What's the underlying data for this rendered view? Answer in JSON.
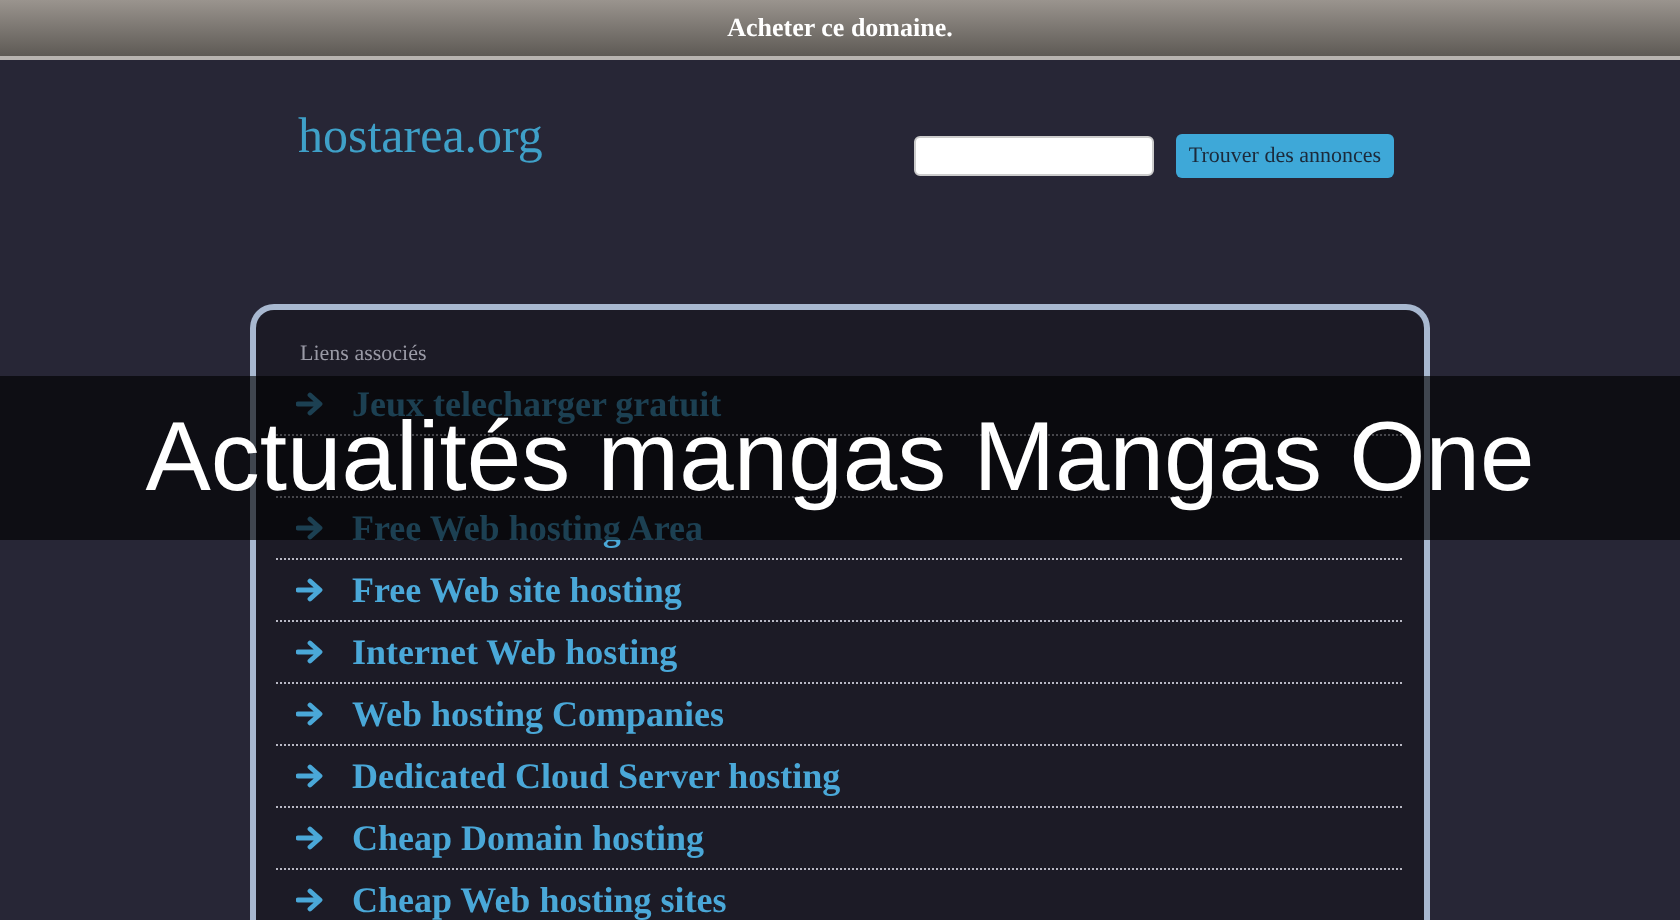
{
  "top_bar": {
    "label": "Acheter ce domaine."
  },
  "header": {
    "logo": "hostarea.org",
    "search": {
      "button": "Trouver des annonces"
    }
  },
  "panel": {
    "heading": "Liens associés",
    "links": [
      {
        "kind": "link",
        "label": "Jeux telecharger gratuit"
      },
      {
        "kind": "covered"
      },
      {
        "kind": "link",
        "label": "Free Web hosting Area"
      },
      {
        "kind": "link",
        "label": "Free Web site hosting"
      },
      {
        "kind": "link",
        "label": "Internet Web hosting"
      },
      {
        "kind": "link",
        "label": "Web hosting Companies"
      },
      {
        "kind": "link",
        "label": "Dedicated Cloud Server hosting"
      },
      {
        "kind": "link",
        "label": "Cheap Domain hosting"
      },
      {
        "kind": "link",
        "label": "Cheap Web hosting sites"
      }
    ]
  },
  "caption": {
    "text": "Actualités mangas Mangas One"
  }
}
